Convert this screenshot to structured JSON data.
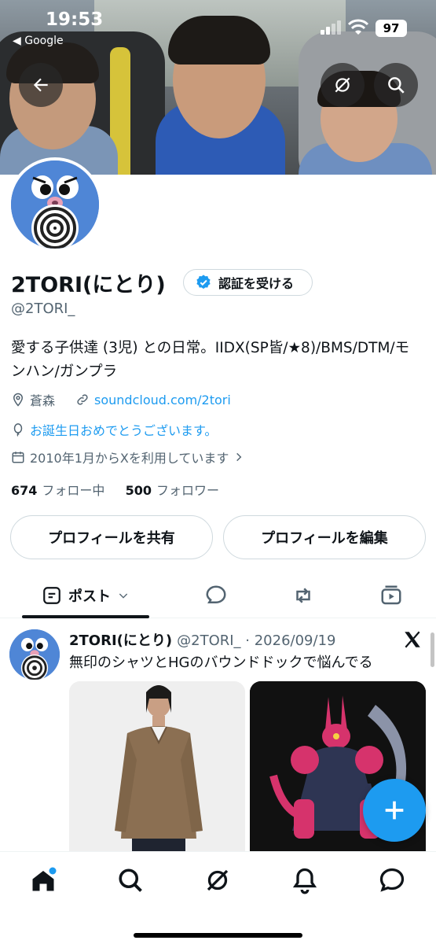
{
  "status_bar": {
    "time": "19:53",
    "back_app": "◀ Google",
    "battery": "97"
  },
  "profile": {
    "name": "2TORI(にとり)",
    "verify_button": "認証を受ける",
    "handle": "@2TORI_",
    "bio": "愛する子供達 (3児) との日常。IIDX(SP皆/★8)/BMS/DTM/モンハン/ガンプラ",
    "location": "蒼森",
    "website": "soundcloud.com/2tori",
    "birthday": "お誕生日おめでとうございます。",
    "joined": "2010年1月からXを利用しています",
    "following_count": "674",
    "following_label": "フォロー中",
    "followers_count": "500",
    "followers_label": "フォロワー",
    "share_button": "プロフィールを共有",
    "edit_button": "プロフィールを編集"
  },
  "tabs": {
    "active_label": "ポスト"
  },
  "post": {
    "author": "2TORI(にとり)",
    "meta": "@2TORI_ · 2026/09/19",
    "text": "無印のシャツとHGのバウンドドックで悩んでる"
  },
  "colors": {
    "accent": "#1d9bf0",
    "text": "#0f1419",
    "secondary": "#536471"
  }
}
